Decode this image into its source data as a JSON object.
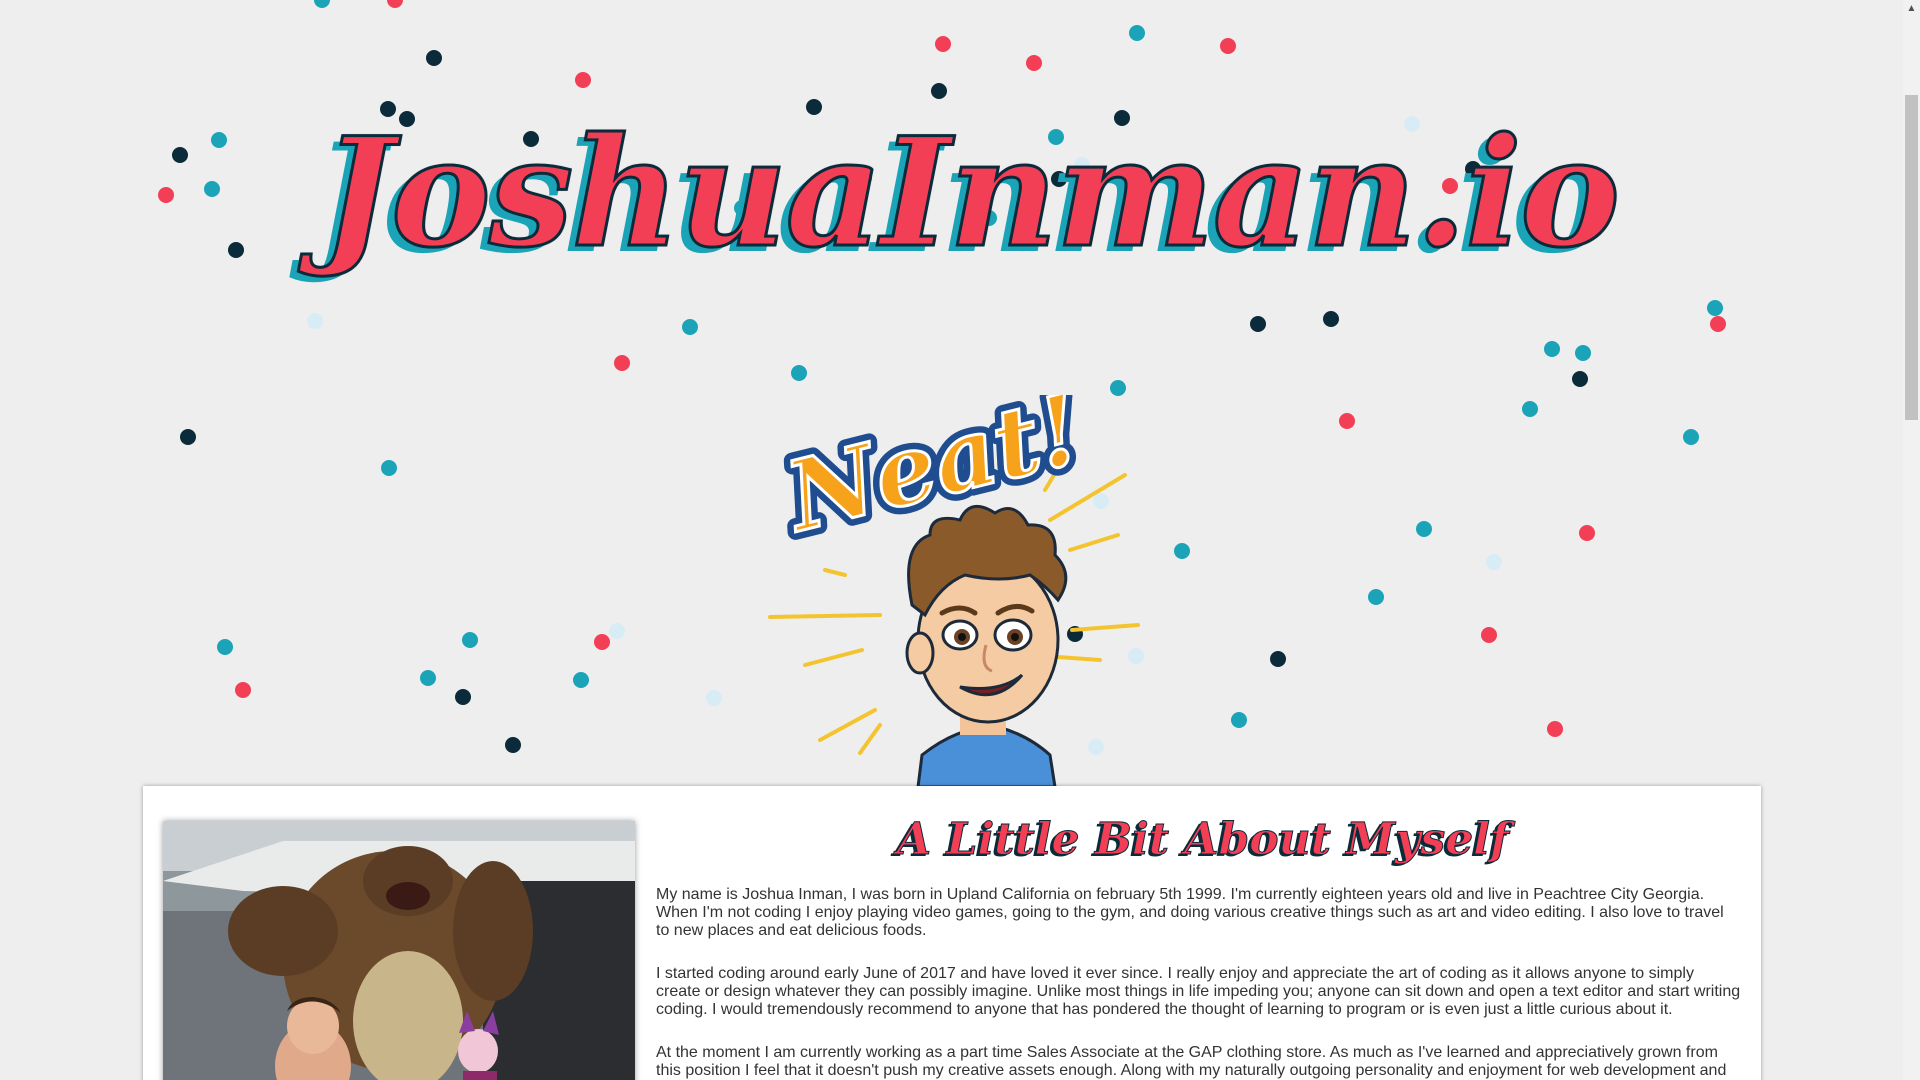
{
  "hero": {
    "title": "JoshuaInman.io"
  },
  "bitmoji": {
    "caption": "Neat!"
  },
  "about": {
    "heading": "A Little Bit About Myself",
    "paragraphs": [
      "My name is Joshua Inman, I was born in Upland California on february 5th 1999. I'm currently eighteen years old and live in Peachtree City Georgia. When I'm not coding I enjoy playing video games, going to the gym, and doing various creative things such as art and video editing. I also love to travel to new places and eat delicious foods.",
      "I started coding around early June of 2017 and have loved it ever since. I really enjoy and appreciate the art of coding as it allows anyone to simply create or design whatever they can possibly imagine. Unlike most things in life impeding you; anyone can sit down and open a text editor and start writing coding. I would tremendously recommend to anyone that has pondered the thought of learning to program or is even just a little curious about it.",
      "At the moment I am currently working as a part time Sales Associate at the GAP clothing store. As much as I've learned and appreciatively grown from this position I feel that it doesn't push my creative assets enough. Along with my naturally outgoing personality and enjoyment for web development and"
    ]
  },
  "colors": {
    "background": "#eeeeee",
    "accent_red": "#f23f55",
    "accent_teal": "#1ba4b7",
    "dark_navy": "#0b2a3a",
    "light_blue": "#d8ecf5"
  },
  "icons": {
    "scroll_up": "chevron-up-icon"
  }
}
